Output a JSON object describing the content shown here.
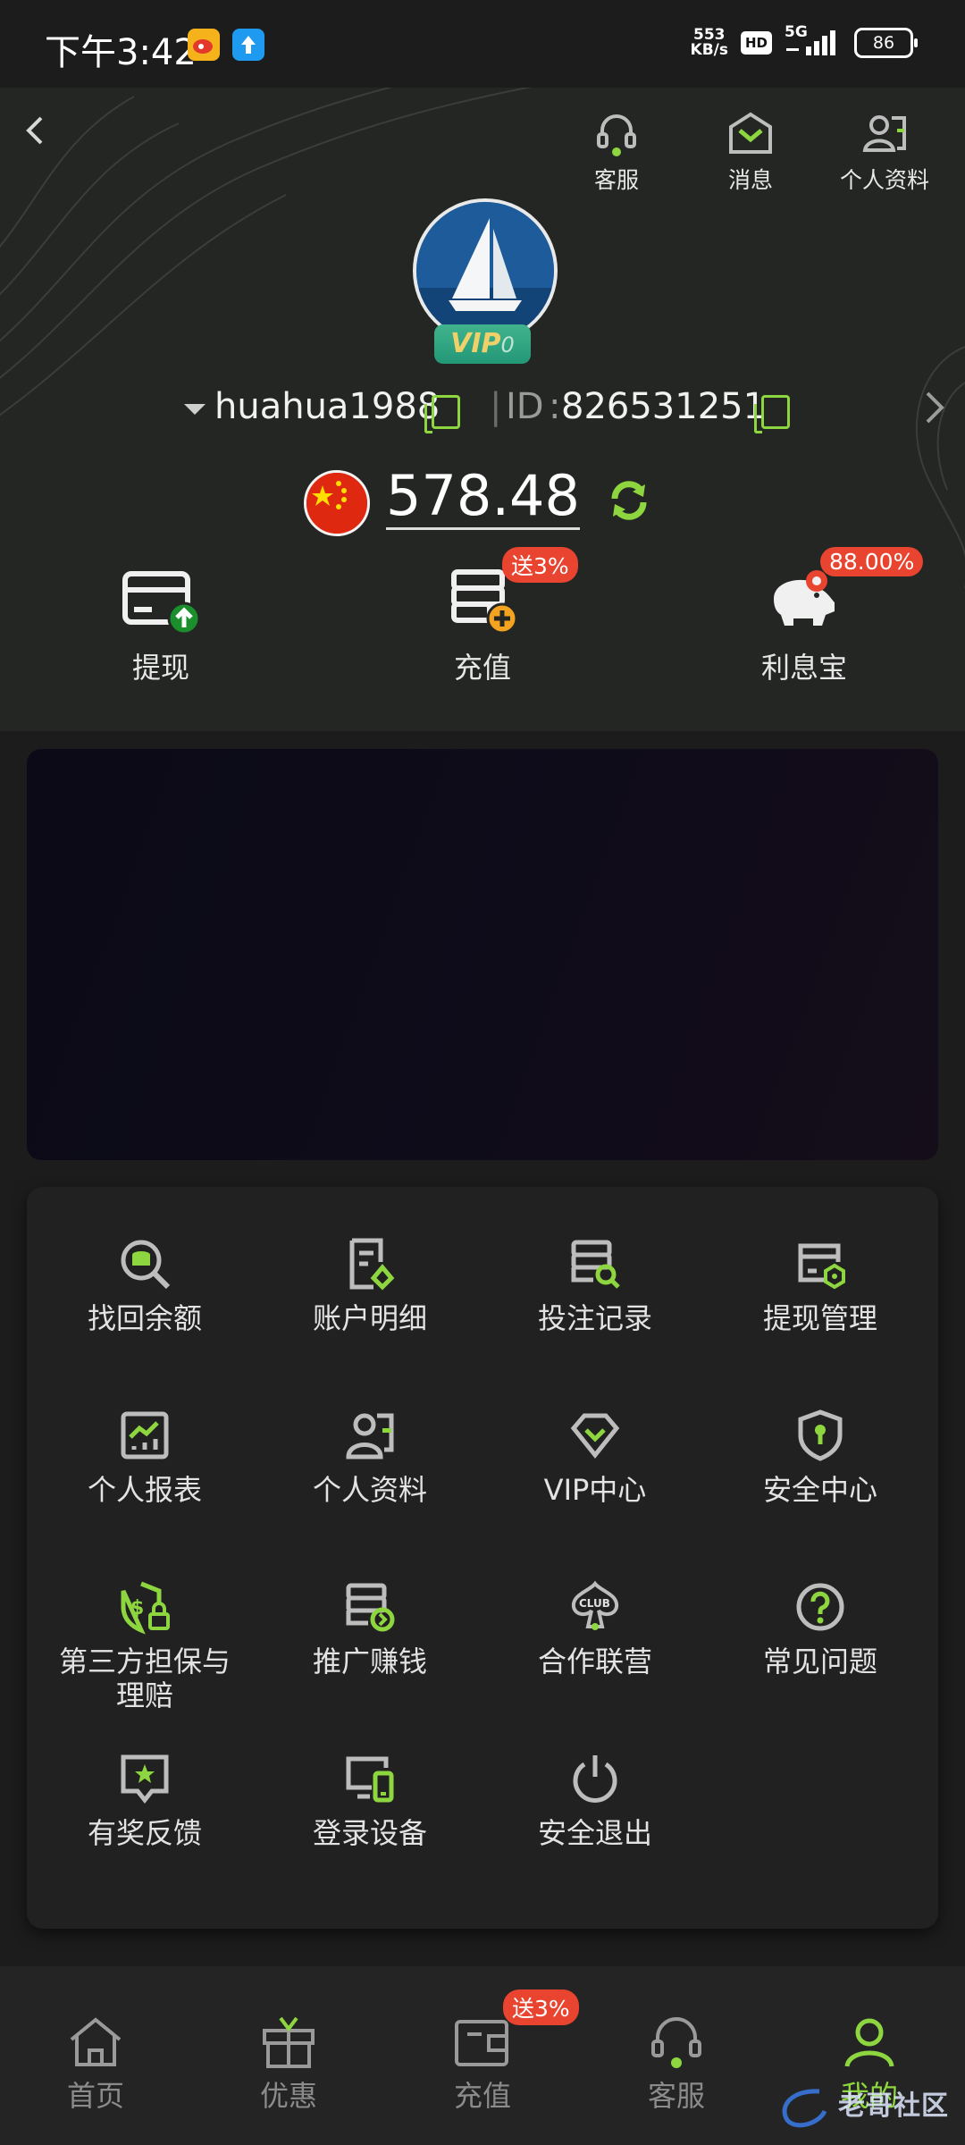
{
  "status_bar": {
    "time": "下午3:42",
    "net_speed_value": "553",
    "net_speed_unit": "KB/s",
    "hd_label": "HD",
    "signal_label": "5G",
    "battery": "86"
  },
  "header": {
    "top_actions": [
      {
        "label": "客服",
        "icon": "headset-icon"
      },
      {
        "label": "消息",
        "icon": "mail-icon"
      },
      {
        "label": "个人资料",
        "icon": "user-card-icon"
      }
    ],
    "vip_label": "VIP",
    "vip_level": "0",
    "username": "huahua1988",
    "id_label": "ID",
    "user_id": "826531251",
    "balance": "578.48"
  },
  "quick_actions": [
    {
      "label": "提现",
      "icon": "withdraw-card-icon"
    },
    {
      "label": "充值",
      "icon": "deposit-icon",
      "badge": "送3%"
    },
    {
      "label": "利息宝",
      "icon": "piggy-bank-icon",
      "badge": "88.00%"
    }
  ],
  "menu": [
    {
      "label": "找回余额",
      "icon": "recover-balance-icon"
    },
    {
      "label": "账户明细",
      "icon": "account-detail-icon"
    },
    {
      "label": "投注记录",
      "icon": "bet-record-icon"
    },
    {
      "label": "提现管理",
      "icon": "withdraw-manage-icon"
    },
    {
      "label": "个人报表",
      "icon": "report-icon"
    },
    {
      "label": "个人资料",
      "icon": "profile-icon"
    },
    {
      "label": "VIP中心",
      "icon": "vip-center-icon"
    },
    {
      "label": "安全中心",
      "icon": "shield-icon"
    },
    {
      "label": "第三方担保与理赔",
      "icon": "guarantee-icon"
    },
    {
      "label": "推广赚钱",
      "icon": "promote-icon"
    },
    {
      "label": "合作联营",
      "icon": "club-icon"
    },
    {
      "label": "常见问题",
      "icon": "question-icon"
    },
    {
      "label": "有奖反馈",
      "icon": "feedback-icon"
    },
    {
      "label": "登录设备",
      "icon": "devices-icon"
    },
    {
      "label": "安全退出",
      "icon": "power-icon"
    }
  ],
  "bottom_nav": [
    {
      "label": "首页",
      "icon": "home-icon"
    },
    {
      "label": "优惠",
      "icon": "gift-icon"
    },
    {
      "label": "充值",
      "icon": "wallet-icon",
      "badge": "送3%"
    },
    {
      "label": "客服",
      "icon": "headset-icon"
    },
    {
      "label": "我的",
      "icon": "user-icon"
    }
  ],
  "watermark": "老哥社区",
  "colors": {
    "accent": "#8ed640",
    "badge": "#e8442f",
    "background": "#1b1c1b"
  }
}
